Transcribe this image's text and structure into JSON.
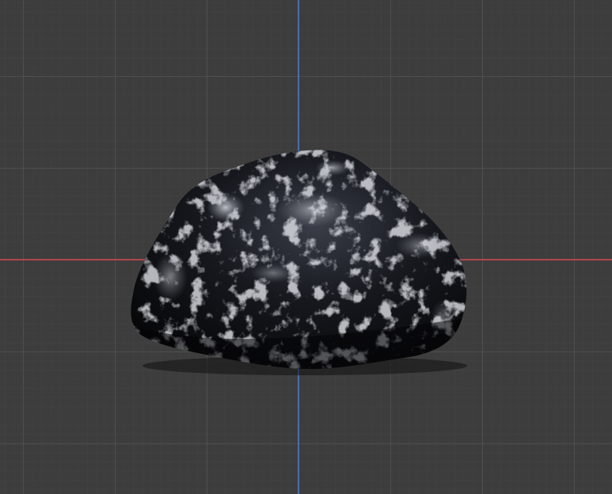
{
  "viewport": {
    "background_color": "#3d3d3d",
    "grid_color": "#5a5a5a"
  },
  "axes": {
    "x_axis_color": "#c8474f",
    "y_axis_color": "#4a78c8"
  },
  "object": {
    "icon": "rock-mesh",
    "base_color": "#0b0c10",
    "highlight_color": "#dfe3ec"
  }
}
